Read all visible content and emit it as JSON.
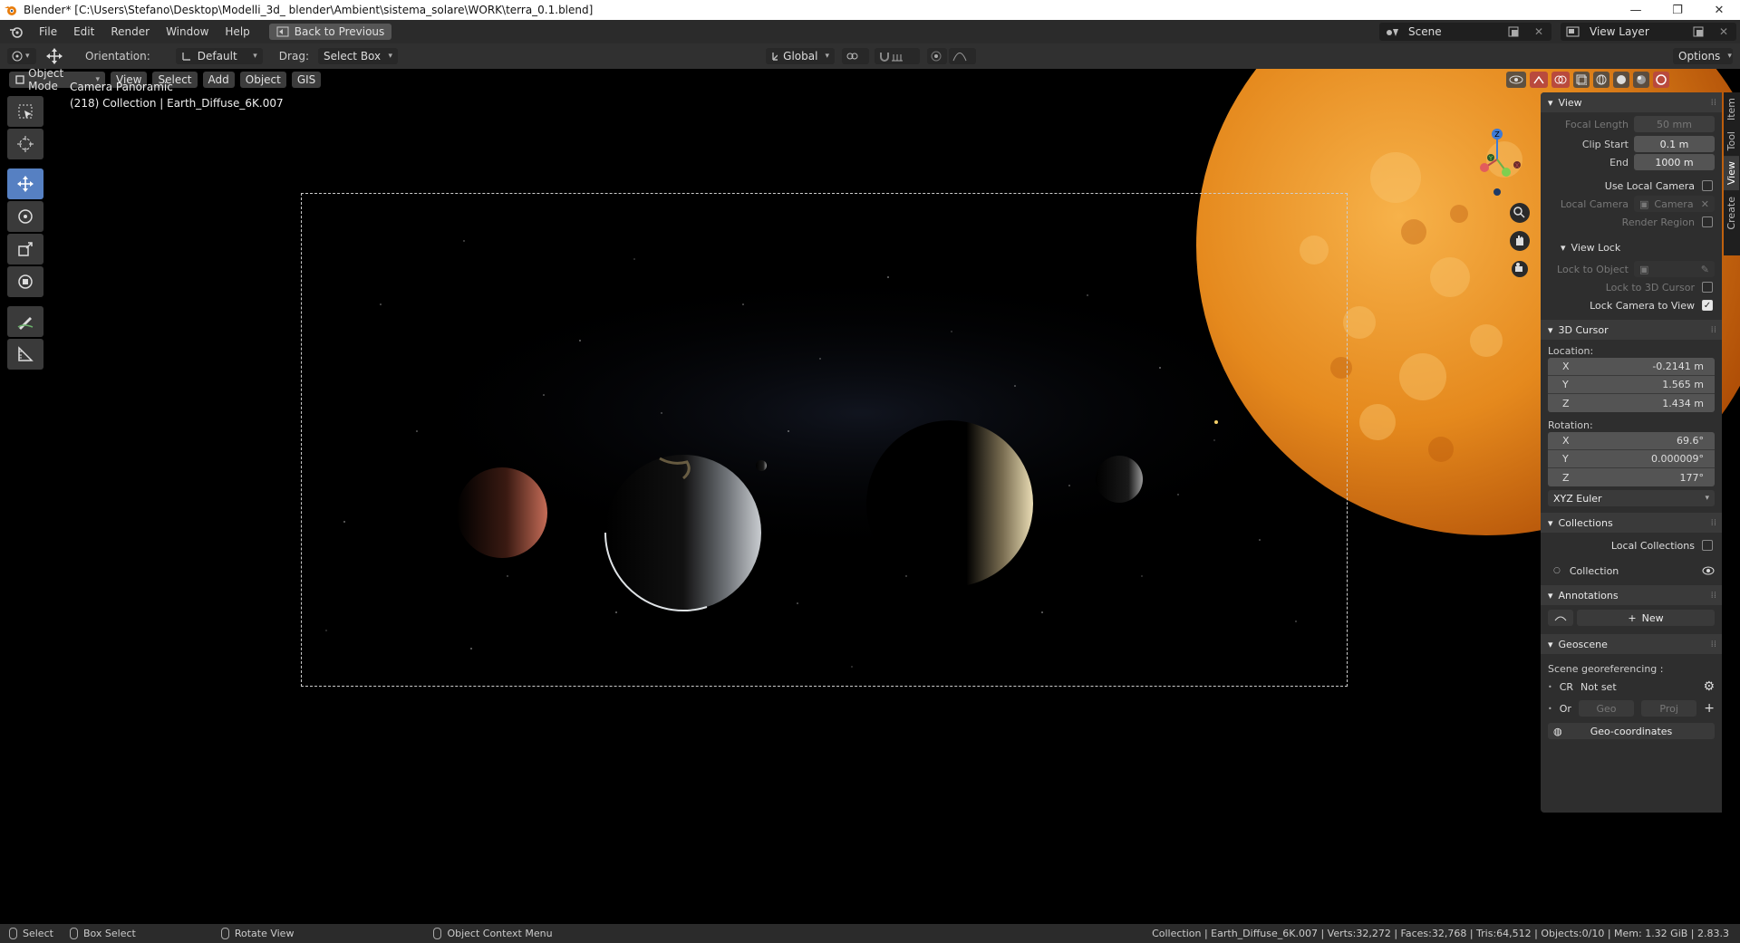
{
  "window": {
    "title": "Blender* [C:\\Users\\Stefano\\Desktop\\Modelli_3d_ blender\\Ambient\\sistema_solare\\WORK\\terra_0.1.blend]",
    "controls": [
      "—",
      "❐",
      "✕"
    ]
  },
  "menubar": {
    "items": [
      "File",
      "Edit",
      "Render",
      "Window",
      "Help"
    ],
    "back_button": "Back to Previous",
    "scene": "Scene",
    "view_layer": "View Layer"
  },
  "toolheader": {
    "orientation_label": "Orientation:",
    "orientation_value": "Default",
    "drag_label": "Drag:",
    "drag_value": "Select Box",
    "transform_orientation": "Global",
    "options": "Options"
  },
  "viewport": {
    "mode": "Object Mode",
    "menus": [
      "View",
      "Select",
      "Add",
      "Object",
      "GIS"
    ],
    "camera_name": "Camera Panoramic",
    "collection_info": "(218) Collection | Earth_Diffuse_6K.007",
    "gizmo_axes": {
      "z": "Z",
      "y": "Y",
      "x": "X"
    }
  },
  "npanel": {
    "tabs": [
      "Item",
      "Tool",
      "View",
      "Create"
    ],
    "view": {
      "header": "View",
      "focal_length_label": "Focal Length",
      "focal_length": "50 mm",
      "clip_start_label": "Clip Start",
      "clip_start": "0.1 m",
      "end_label": "End",
      "end": "1000 m",
      "use_local_camera": "Use Local Camera",
      "local_camera_label": "Local Camera",
      "local_camera_value": "Camera",
      "render_region": "Render Region"
    },
    "view_lock": {
      "header": "View Lock",
      "lock_to_object": "Lock to Object",
      "lock_to_3d_cursor": "Lock to 3D Cursor",
      "lock_camera_to_view": "Lock Camera to View"
    },
    "cursor": {
      "header": "3D Cursor",
      "location_label": "Location:",
      "loc_x": "-0.2141 m",
      "loc_y": "1.565 m",
      "loc_z": "1.434 m",
      "rotation_label": "Rotation:",
      "rot_x": "69.6°",
      "rot_y": "0.000009°",
      "rot_z": "177°",
      "rotation_mode": "XYZ Euler",
      "axis_x": "X",
      "axis_y": "Y",
      "axis_z": "Z"
    },
    "collections": {
      "header": "Collections",
      "local_collections": "Local Collections",
      "collection_name": "Collection"
    },
    "annotations": {
      "header": "Annotations",
      "new_button": "New"
    },
    "geoscene": {
      "header": "Geoscene",
      "scene_georef": "Scene georeferencing :",
      "cr_label": "CR",
      "cr_value": "Not set",
      "or_label": "Or",
      "geo_btn": "Geo",
      "proj_btn": "Proj",
      "geo_coordinates": "Geo-coordinates"
    }
  },
  "statusbar": {
    "select": "Select",
    "box_select": "Box Select",
    "rotate_view": "Rotate View",
    "context_menu": "Object Context Menu",
    "stats": "Collection | Earth_Diffuse_6K.007 | Verts:32,272 | Faces:32,768 | Tris:64,512 | Objects:0/10 | Mem: 1.32 GiB | 2.83.3"
  },
  "colors": {
    "accent_blue": "#5680c2",
    "sun_orange": "#e08a1c",
    "panel_bg": "#2e2e2e"
  }
}
